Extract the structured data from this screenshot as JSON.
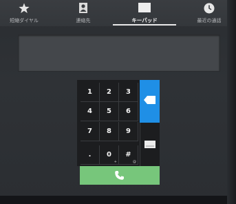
{
  "tabs": [
    {
      "label": "短縮ダイヤル",
      "icon": "star-icon"
    },
    {
      "label": "連絡先",
      "icon": "contacts-icon"
    },
    {
      "label": "キーパッド",
      "icon": "keypad-icon",
      "active": true
    },
    {
      "label": "最近の通話",
      "icon": "recent-calls-icon"
    }
  ],
  "display": {
    "number": ""
  },
  "keypad": {
    "keys": [
      {
        "main": "1",
        "sub": ""
      },
      {
        "main": "2",
        "sub": ""
      },
      {
        "main": "3",
        "sub": ""
      },
      {
        "main": "4",
        "sub": ""
      },
      {
        "main": "5",
        "sub": ""
      },
      {
        "main": "6",
        "sub": ""
      },
      {
        "main": "7",
        "sub": ""
      },
      {
        "main": "8",
        "sub": ""
      },
      {
        "main": "9",
        "sub": ""
      },
      {
        "main": ".",
        "sub": ""
      },
      {
        "main": "0",
        "sub": "+"
      },
      {
        "main": "#",
        "sub": "@"
      }
    ],
    "backspace_icon": "backspace-icon",
    "message_icon": "message-icon",
    "call_icon": "phone-icon"
  },
  "colors": {
    "accent_blue": "#1f8fe6",
    "call_green": "#77c67b",
    "tabbar_bg": "#3a3d41",
    "screen_bg": "#2f3236"
  }
}
